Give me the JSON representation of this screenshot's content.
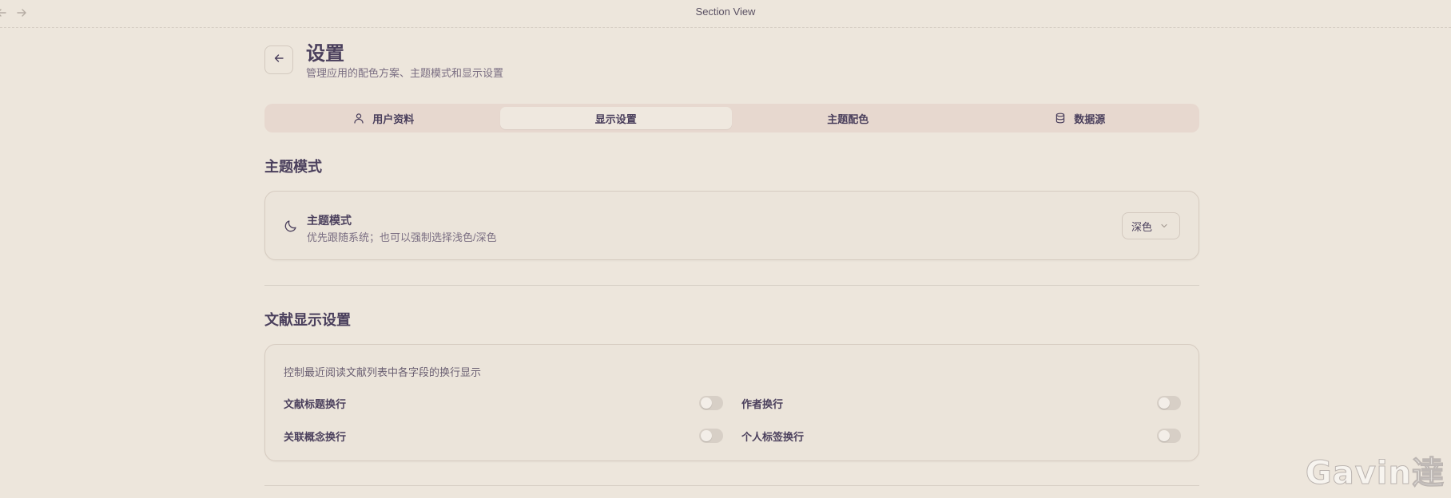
{
  "window": {
    "title": "Section View"
  },
  "header": {
    "title": "设置",
    "subtitle": "管理应用的配色方案、主题模式和显示设置"
  },
  "tabs": [
    {
      "label": "用户资料",
      "icon": "user-icon",
      "active": false
    },
    {
      "label": "显示设置",
      "icon": "",
      "active": true
    },
    {
      "label": "主题配色",
      "icon": "",
      "active": false
    },
    {
      "label": "数据源",
      "icon": "database-icon",
      "active": false
    }
  ],
  "theme_section": {
    "heading": "主题模式",
    "row_label": "主题模式",
    "row_desc": "优先跟随系统；也可以强制选择浅色/深色",
    "select_value": "深色",
    "icon": "moon-icon"
  },
  "doc_section": {
    "heading": "文献显示设置",
    "desc": "控制最近阅读文献列表中各字段的换行显示",
    "toggles": [
      {
        "label": "文献标题换行",
        "on": false
      },
      {
        "label": "作者换行",
        "on": false
      },
      {
        "label": "关联概念换行",
        "on": false
      },
      {
        "label": "个人标签换行",
        "on": false
      }
    ]
  },
  "watermark": {
    "text": "Gavin達"
  },
  "colors": {
    "background": "#ede6dc",
    "accent_text": "#4a3f5c",
    "tabbar": "#e7d8cf"
  }
}
